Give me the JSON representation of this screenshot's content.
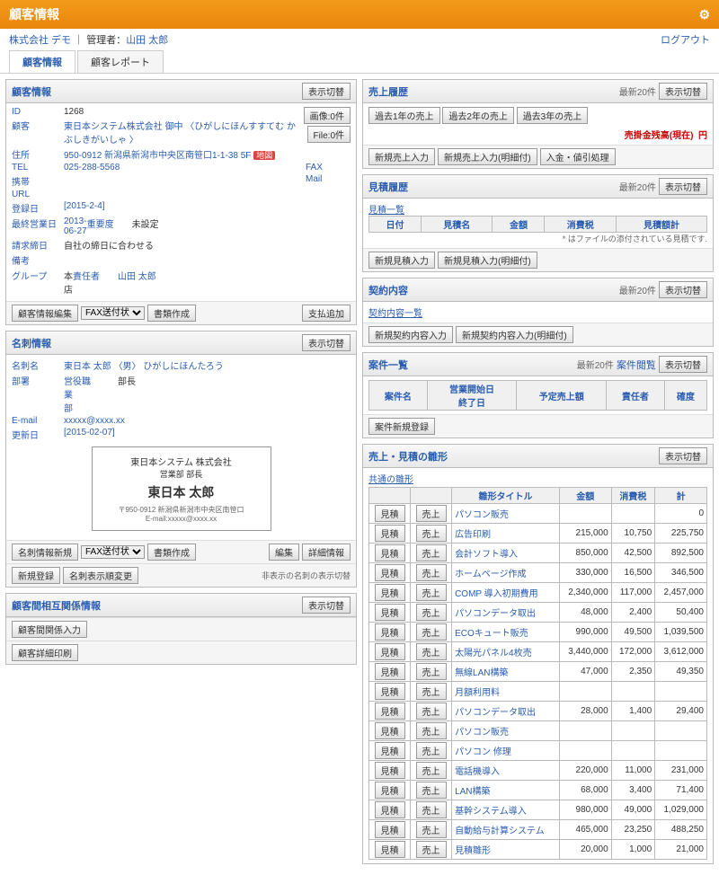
{
  "header": {
    "title": "顧客情報",
    "logout": "ログアウト"
  },
  "sub": {
    "company": "株式会社 デモ",
    "sep": "｜",
    "mgr_lbl": "管理者：",
    "mgr": "山田 太郎"
  },
  "tabs": [
    "顧客情報",
    "顧客レポート"
  ],
  "cust": {
    "title": "顧客情報",
    "toggle": "表示切替",
    "img_btn": "画像:0件",
    "file_btn": "File:0件",
    "id_l": "ID",
    "id": "1268",
    "name_l": "顧客",
    "name": "東日本システム株式会社 御中",
    "kana": "〈ひがしにほんすすてむ かぶしきがいしゃ 〉",
    "addr_l": "住所",
    "addr": "950-0912 新潟県新潟市中央区南笹口1-1-38 5F",
    "map": "地図",
    "tel_l": "TEL",
    "tel": "025-288-5568",
    "fax_l": "FAX",
    "fax": "",
    "mob_l": "携帯",
    "mob": "",
    "mail_l": "Mail",
    "mail": "",
    "url_l": "URL",
    "url": "",
    "reg_l": "登録日",
    "reg": "[2015-2-4]",
    "last_l": "最終営業日",
    "last": "2013-06-27",
    "pri_l": "重要度",
    "pri": "未設定",
    "bill_l": "請求締日",
    "bill": "自社の締日に合わせる",
    "rem_l": "備考",
    "rem": "",
    "grp_l": "グループ",
    "grp": "本店",
    "own_l": "責任者",
    "own": "山田 太郎",
    "edit": "顧客情報編集",
    "sel": "FAX送付状",
    "doc": "書類作成",
    "pay": "支払追加"
  },
  "mei": {
    "title": "名刺情報",
    "toggle": "表示切替",
    "name_l": "名刺名",
    "name": "東日本 太郎",
    "gender": "〈男〉",
    "kana": "ひがしにほんたろう",
    "dept_l": "部署",
    "dept": "営業部",
    "role_l": "役職",
    "role": "部長",
    "mail_l": "E-mail",
    "mail": "xxxxx@xxxx.xx",
    "upd_l": "更新日",
    "upd": "[2015-02-07]",
    "card_co": "東日本システム 株式会社",
    "card_dept": "営業部 部長",
    "card_name": "東日本 太郎",
    "card_addr": "〒950-0912 新潟県新潟市中央区南笹口",
    "card_mail": "E-mail:xxxxx@xxxx.xx",
    "new": "名刺情報新規",
    "sel": "FAX送付状",
    "doc": "書類作成",
    "edit": "編集",
    "detail": "詳細情報",
    "reg": "新規登録",
    "order": "名刺表示順変更",
    "hide": "非表示の名刺の表示切替"
  },
  "rel": {
    "title": "顧客間相互関係情報",
    "toggle": "表示切替",
    "btn1": "顧客間関係入力",
    "btn2": "顧客詳細印刷"
  },
  "uri": {
    "title": "売上履歴",
    "meta": "最新20件",
    "toggle": "表示切替",
    "y1": "過去1年の売上",
    "y2": "過去2年の売上",
    "y3": "過去3年の売上",
    "bal": "売掛金残高(現在)",
    "yen": "円",
    "b1": "新規売上入力",
    "b2": "新規売上入力(明細付)",
    "b3": "入金・値引処理"
  },
  "mit": {
    "title": "見積履歴",
    "meta": "最新20件",
    "toggle": "表示切替",
    "list": "見積一覧",
    "h": [
      "日付",
      "見積名",
      "金額",
      "消費税",
      "見積額計"
    ],
    "note": "* はファイルの添付されている見積です.",
    "b1": "新規見積入力",
    "b2": "新規見積入力(明細付)"
  },
  "kei": {
    "title": "契約内容",
    "meta": "最新20件",
    "toggle": "表示切替",
    "list": "契約内容一覧",
    "b1": "新規契約内容入力",
    "b2": "新規契約内容入力(明細付)"
  },
  "ank": {
    "title": "案件一覧",
    "meta": "最新20件",
    "browse": "案件閲覧",
    "toggle": "表示切替",
    "h": [
      "案件名",
      "営業開始日\n終了日",
      "予定売上額",
      "責任者",
      "確度"
    ],
    "b1": "案件新規登録"
  },
  "hina": {
    "title": "売上・見積の雛形",
    "toggle": "表示切替",
    "sub": "共通の雛形",
    "h": [
      "",
      "",
      "雛形タイトル",
      "金額",
      "消費税",
      "計"
    ],
    "rows": [
      {
        "a": "見積",
        "b": "売上",
        "t": "パソコン販売",
        "k": "",
        "z": "",
        "s": "0"
      },
      {
        "a": "見積",
        "b": "売上",
        "t": "広告印刷",
        "k": "215,000",
        "z": "10,750",
        "s": "225,750"
      },
      {
        "a": "見積",
        "b": "売上",
        "t": "会計ソフト導入",
        "k": "850,000",
        "z": "42,500",
        "s": "892,500"
      },
      {
        "a": "見積",
        "b": "売上",
        "t": "ホームページ作成",
        "k": "330,000",
        "z": "16,500",
        "s": "346,500"
      },
      {
        "a": "見積",
        "b": "売上",
        "t": "COMP 導入初期費用",
        "k": "2,340,000",
        "z": "117,000",
        "s": "2,457,000"
      },
      {
        "a": "見積",
        "b": "売上",
        "t": "パソコンデータ取出",
        "k": "48,000",
        "z": "2,400",
        "s": "50,400"
      },
      {
        "a": "見積",
        "b": "売上",
        "t": "ECOキュート販売",
        "k": "990,000",
        "z": "49,500",
        "s": "1,039,500"
      },
      {
        "a": "見積",
        "b": "売上",
        "t": "太陽光パネル4枚売",
        "k": "3,440,000",
        "z": "172,000",
        "s": "3,612,000"
      },
      {
        "a": "見積",
        "b": "売上",
        "t": "無線LAN構築",
        "k": "47,000",
        "z": "2,350",
        "s": "49,350"
      },
      {
        "a": "見積",
        "b": "売上",
        "t": "月額利用料",
        "k": "",
        "z": "",
        "s": ""
      },
      {
        "a": "見積",
        "b": "売上",
        "t": "パソコンデータ取出",
        "k": "28,000",
        "z": "1,400",
        "s": "29,400"
      },
      {
        "a": "見積",
        "b": "売上",
        "t": "パソコン販売",
        "k": "",
        "z": "",
        "s": ""
      },
      {
        "a": "見積",
        "b": "売上",
        "t": "パソコン 修理",
        "k": "",
        "z": "",
        "s": ""
      },
      {
        "a": "見積",
        "b": "売上",
        "t": "電話機導入",
        "k": "220,000",
        "z": "11,000",
        "s": "231,000"
      },
      {
        "a": "見積",
        "b": "売上",
        "t": "LAN構築",
        "k": "68,000",
        "z": "3,400",
        "s": "71,400"
      },
      {
        "a": "見積",
        "b": "売上",
        "t": "基幹システム導入",
        "k": "980,000",
        "z": "49,000",
        "s": "1,029,000"
      },
      {
        "a": "見積",
        "b": "売上",
        "t": "自動給与計算システム",
        "k": "465,000",
        "z": "23,250",
        "s": "488,250"
      },
      {
        "a": "見積",
        "b": "売上",
        "t": "見積雛形",
        "k": "20,000",
        "z": "1,000",
        "s": "21,000"
      }
    ]
  }
}
